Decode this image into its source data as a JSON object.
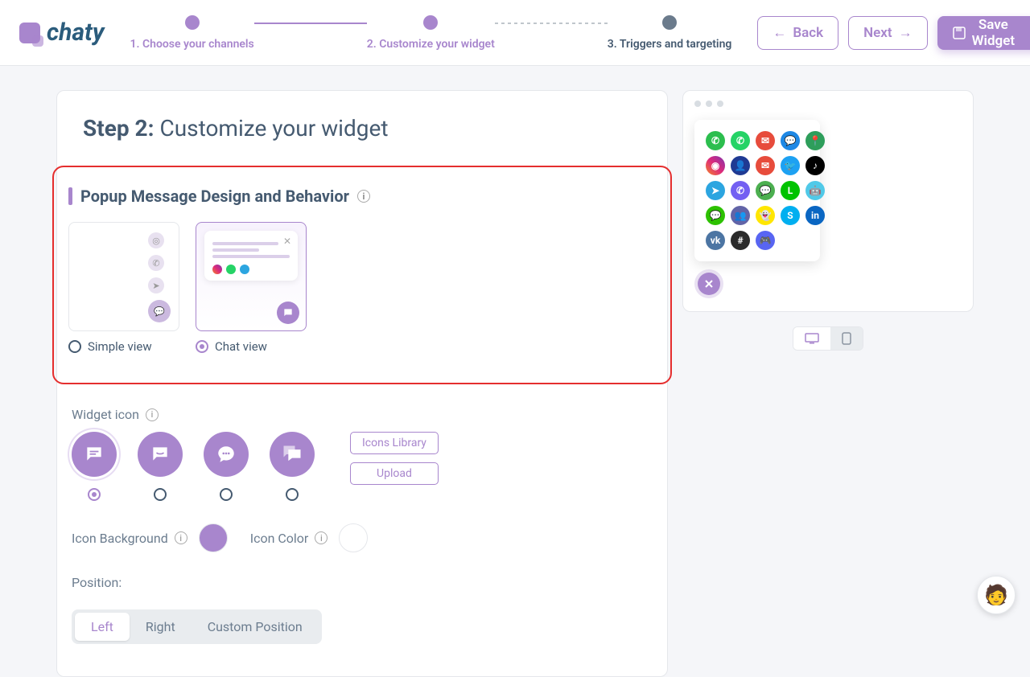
{
  "brand": "chaty",
  "stepper": {
    "steps": [
      {
        "num": "1.",
        "label": "Choose your channels",
        "state": "done"
      },
      {
        "num": "2.",
        "label": "Customize your widget",
        "state": "active"
      },
      {
        "num": "3.",
        "label": "Triggers and targeting",
        "state": "future"
      }
    ]
  },
  "actions": {
    "back": "Back",
    "next": "Next",
    "save": "Save Widget"
  },
  "heading": {
    "step": "Step 2:",
    "title": "Customize your widget"
  },
  "popup": {
    "title": "Popup Message Design and Behavior",
    "options": [
      {
        "label": "Simple view",
        "selected": false
      },
      {
        "label": "Chat view",
        "selected": true
      }
    ]
  },
  "widget_icon": {
    "label": "Widget icon",
    "options": [
      {
        "name": "chat-bubble-icon",
        "selected": true
      },
      {
        "name": "smile-bubble-icon",
        "selected": false
      },
      {
        "name": "dots-bubble-icon",
        "selected": false
      },
      {
        "name": "double-bubble-icon",
        "selected": false
      }
    ],
    "icons_library": "Icons Library",
    "upload": "Upload"
  },
  "icon_background": {
    "label": "Icon Background",
    "color": "#A886CD"
  },
  "icon_color": {
    "label": "Icon Color",
    "color": "#FFFFFF"
  },
  "position": {
    "label": "Position:",
    "options": [
      "Left",
      "Right",
      "Custom Position"
    ],
    "selected": "Left"
  },
  "preview": {
    "channels": [
      {
        "name": "phone",
        "bg": "#2CBE4E"
      },
      {
        "name": "whatsapp",
        "bg": "#25D366"
      },
      {
        "name": "email",
        "bg": "#E74C3C"
      },
      {
        "name": "messenger",
        "bg": "#1E88E5"
      },
      {
        "name": "maps",
        "bg": "#2E9E5B"
      },
      {
        "name": "instagram",
        "bg": "linear-gradient(45deg,#F58529,#DD2A7B,#8134AF)"
      },
      {
        "name": "contact",
        "bg": "#1F3A93"
      },
      {
        "name": "sms",
        "bg": "#E74C3C"
      },
      {
        "name": "twitter",
        "bg": "#1DA1F2"
      },
      {
        "name": "tiktok",
        "bg": "#000"
      },
      {
        "name": "telegram",
        "bg": "#2CA5E0"
      },
      {
        "name": "viber",
        "bg": "#7360F2"
      },
      {
        "name": "wechat-m",
        "bg": "#4CAF50"
      },
      {
        "name": "line",
        "bg": "#00C300"
      },
      {
        "name": "bot",
        "bg": "#50C9E8"
      },
      {
        "name": "wechat",
        "bg": "#2DC100"
      },
      {
        "name": "teams",
        "bg": "#6264A7"
      },
      {
        "name": "snapchat",
        "bg": "#FFE600"
      },
      {
        "name": "skype",
        "bg": "#00AFF0"
      },
      {
        "name": "linkedin",
        "bg": "#0A66C2"
      },
      {
        "name": "vk",
        "bg": "#4C75A3"
      },
      {
        "name": "slack",
        "bg": "#2B2B2B"
      },
      {
        "name": "discord",
        "bg": "#5865F2"
      }
    ],
    "device_selected": "desktop"
  }
}
